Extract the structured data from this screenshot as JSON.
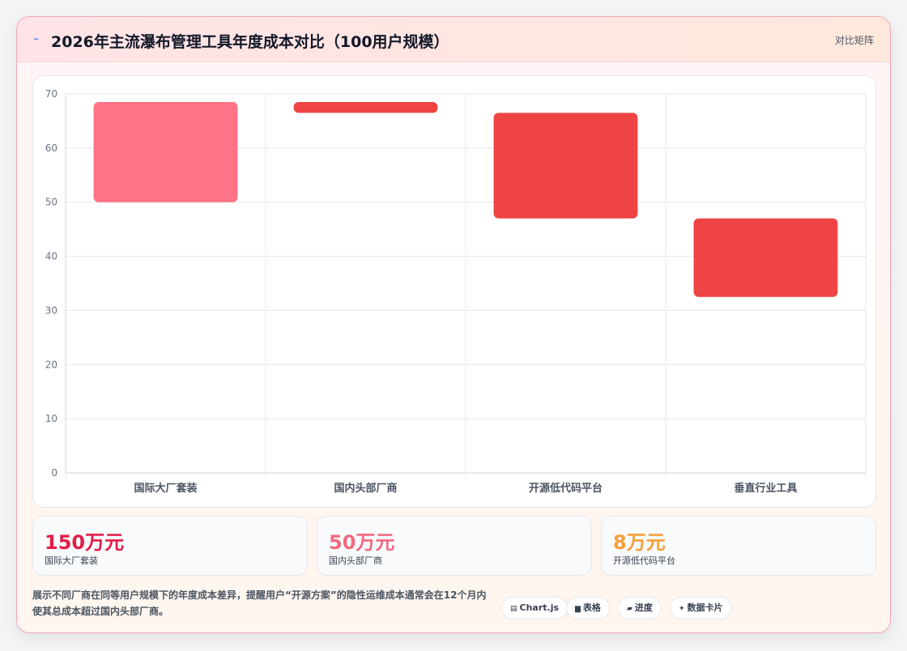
{
  "header": {
    "title": "2026年主流瀑布管理工具年度成本对比（100用户规模）",
    "badge": "对比矩阵"
  },
  "chart_data": {
    "type": "bar",
    "subtype": "floating-range",
    "categories": [
      "国际大厂套装",
      "国内头部厂商",
      "开源低代码平台",
      "垂直行业工具"
    ],
    "ranges": [
      [
        50,
        68.5
      ],
      [
        66.5,
        68.5
      ],
      [
        47,
        66.5
      ],
      [
        32.5,
        47
      ]
    ],
    "colors": [
      "#ff7386",
      "#ef4444",
      "#ef4444",
      "#ef4444"
    ],
    "ylim": [
      0,
      70
    ],
    "yticks": [
      0,
      10,
      20,
      30,
      40,
      50,
      60,
      70
    ],
    "grid": true,
    "legend": "none"
  },
  "stats": [
    {
      "value": "150万元",
      "label": "国际大厂套装",
      "color": "#e11d48"
    },
    {
      "value": "50万元",
      "label": "国内头部厂商",
      "color": "#f06a7f"
    },
    {
      "value": "8万元",
      "label": "开源低代码平台",
      "color": "#f59e3b"
    }
  ],
  "footer": {
    "note": "展示不同厂商在同等用户规模下的年度成本差异，提醒用户“开源方案”的隐性运维成本通常会在12个月内使其总成本超过国内头部厂商。"
  },
  "tags": [
    {
      "label": "Chart.js",
      "icon": "chart-icon",
      "glyph": "▤"
    },
    {
      "label": "表格",
      "icon": "table-icon",
      "glyph": "▆"
    },
    {
      "label": "进度",
      "icon": "progress-icon",
      "glyph": "▰"
    },
    {
      "label": "数据卡片",
      "icon": "sparkle-icon",
      "glyph": "✦"
    }
  ]
}
